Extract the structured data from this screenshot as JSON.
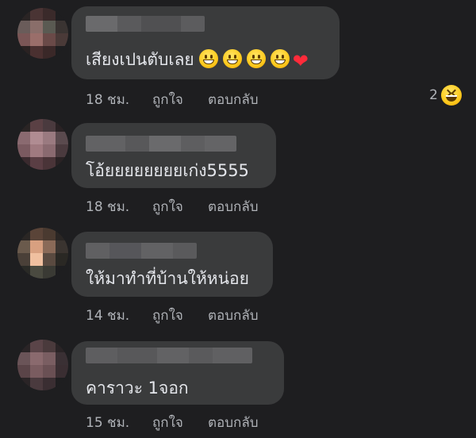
{
  "comments": [
    {
      "text": "เสียงเปนตับเลย",
      "time": "18 ชม.",
      "like_label": "ถูกใจ",
      "reply_label": "ตอบกลับ",
      "reaction_count": "2",
      "reaction_icon": "laugh-reaction-icon"
    },
    {
      "text": "โอ้ยยยยยยยยเก่ง5555",
      "time": "18 ชม.",
      "like_label": "ถูกใจ",
      "reply_label": "ตอบกลับ"
    },
    {
      "text": "ให้มาทำที่บ้านให้หน่อย",
      "time": "14 ชม.",
      "like_label": "ถูกใจ",
      "reply_label": "ตอบกลับ"
    },
    {
      "text": "คาราวะ 1จอก",
      "time": "15 ชม.",
      "like_label": "ถูกใจ",
      "reply_label": "ตอบกลับ"
    }
  ],
  "colors": {
    "background": "#1e1e20",
    "bubble": "#3a3b3c",
    "text": "#e4e6eb",
    "meta": "#b0b3b8"
  }
}
